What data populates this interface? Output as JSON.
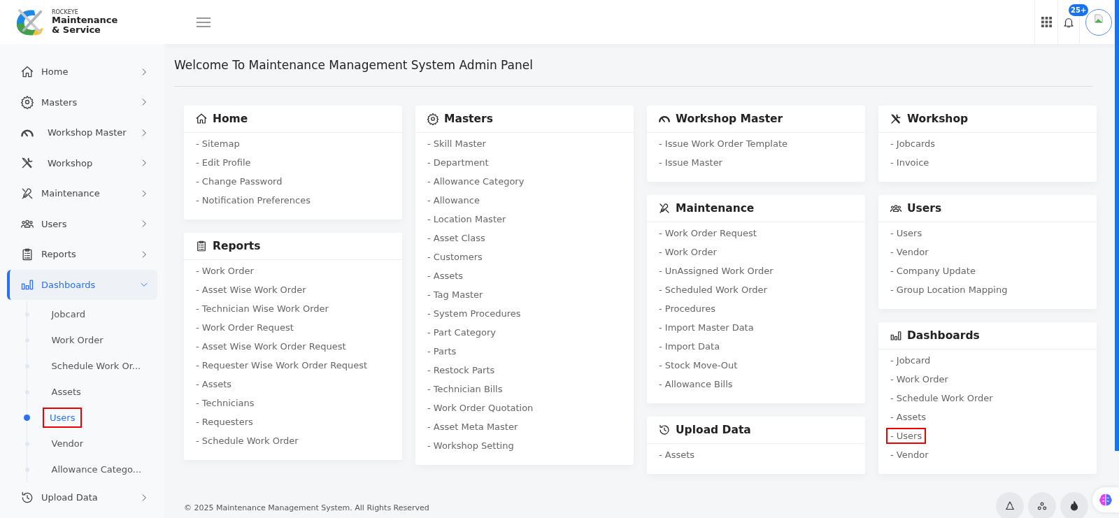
{
  "header": {
    "brand_small": "ROCKEYE",
    "brand_line1": "Maintenance",
    "brand_line2": "& Service",
    "notification_badge": "25+"
  },
  "sidebar": {
    "items": [
      {
        "label": "Home",
        "expanded": false,
        "selected": false
      },
      {
        "label": "Masters",
        "expanded": false,
        "selected": false
      },
      {
        "label": "Workshop Master",
        "expanded": false,
        "selected": false
      },
      {
        "label": "Workshop",
        "expanded": false,
        "selected": false
      },
      {
        "label": "Maintenance",
        "expanded": false,
        "selected": false
      },
      {
        "label": "Users",
        "expanded": false,
        "selected": false
      },
      {
        "label": "Reports",
        "expanded": false,
        "selected": false
      },
      {
        "label": "Dashboards",
        "expanded": true,
        "selected": true,
        "children": [
          {
            "label": "Jobcard",
            "selected": false,
            "highlighted": false
          },
          {
            "label": "Work Order",
            "selected": false,
            "highlighted": false
          },
          {
            "label": "Schedule Work Or...",
            "selected": false,
            "highlighted": false
          },
          {
            "label": "Assets",
            "selected": false,
            "highlighted": false
          },
          {
            "label": "Users",
            "selected": true,
            "highlighted": true
          },
          {
            "label": "Vendor",
            "selected": false,
            "highlighted": false
          },
          {
            "label": "Allowance Catego...",
            "selected": false,
            "highlighted": false
          }
        ]
      },
      {
        "label": "Upload Data",
        "expanded": false,
        "selected": false
      }
    ]
  },
  "main": {
    "title": "Welcome To Maintenance Management System Admin Panel",
    "card_columns": [
      [
        {
          "title": "Home",
          "items": [
            {
              "label": "- Sitemap",
              "highlighted": false
            },
            {
              "label": "- Edit Profile",
              "highlighted": false
            },
            {
              "label": "- Change Password",
              "highlighted": false
            },
            {
              "label": "- Notification Preferences",
              "highlighted": false
            }
          ]
        },
        {
          "title": "Reports",
          "items": [
            {
              "label": "- Work Order",
              "highlighted": false
            },
            {
              "label": "- Asset Wise Work Order",
              "highlighted": false
            },
            {
              "label": "- Technician Wise Work Order",
              "highlighted": false
            },
            {
              "label": "- Work Order Request",
              "highlighted": false
            },
            {
              "label": "- Asset Wise Work Order Request",
              "highlighted": false
            },
            {
              "label": "- Requester Wise Work Order Request",
              "highlighted": false
            },
            {
              "label": "- Assets",
              "highlighted": false
            },
            {
              "label": "- Technicians",
              "highlighted": false
            },
            {
              "label": "- Requesters",
              "highlighted": false
            },
            {
              "label": "- Schedule Work Order",
              "highlighted": false
            }
          ]
        }
      ],
      [
        {
          "title": "Masters",
          "items": [
            {
              "label": "- Skill Master",
              "highlighted": false
            },
            {
              "label": "- Department",
              "highlighted": false
            },
            {
              "label": "- Allowance Category",
              "highlighted": false
            },
            {
              "label": "- Allowance",
              "highlighted": false
            },
            {
              "label": "- Location Master",
              "highlighted": false
            },
            {
              "label": "- Asset Class",
              "highlighted": false
            },
            {
              "label": "- Customers",
              "highlighted": false
            },
            {
              "label": "- Assets",
              "highlighted": false
            },
            {
              "label": "- Tag Master",
              "highlighted": false
            },
            {
              "label": "- System Procedures",
              "highlighted": false
            },
            {
              "label": "- Part Category",
              "highlighted": false
            },
            {
              "label": "- Parts",
              "highlighted": false
            },
            {
              "label": "- Restock Parts",
              "highlighted": false
            },
            {
              "label": "- Technician Bills",
              "highlighted": false
            },
            {
              "label": "- Work Order Quotation",
              "highlighted": false
            },
            {
              "label": "- Asset Meta Master",
              "highlighted": false
            },
            {
              "label": "- Workshop Setting",
              "highlighted": false
            }
          ]
        }
      ],
      [
        {
          "title": "Workshop Master",
          "items": [
            {
              "label": "- Issue Work Order Template",
              "highlighted": false
            },
            {
              "label": "- Issue Master",
              "highlighted": false
            }
          ]
        },
        {
          "title": "Maintenance",
          "items": [
            {
              "label": "- Work Order Request",
              "highlighted": false
            },
            {
              "label": "- Work Order",
              "highlighted": false
            },
            {
              "label": "- UnAssigned Work Order",
              "highlighted": false
            },
            {
              "label": "- Scheduled Work Order",
              "highlighted": false
            },
            {
              "label": "- Procedures",
              "highlighted": false
            },
            {
              "label": "- Import Master Data",
              "highlighted": false
            },
            {
              "label": "- Import Data",
              "highlighted": false
            },
            {
              "label": "- Stock Move-Out",
              "highlighted": false
            },
            {
              "label": "- Allowance Bills",
              "highlighted": false
            }
          ]
        },
        {
          "title": "Upload Data",
          "items": [
            {
              "label": "- Assets",
              "highlighted": false
            }
          ]
        }
      ],
      [
        {
          "title": "Workshop",
          "items": [
            {
              "label": "- Jobcards",
              "highlighted": false
            },
            {
              "label": "- Invoice",
              "highlighted": false
            }
          ]
        },
        {
          "title": "Users",
          "items": [
            {
              "label": "- Users",
              "highlighted": false
            },
            {
              "label": "- Vendor",
              "highlighted": false
            },
            {
              "label": "- Company Update",
              "highlighted": false
            },
            {
              "label": "- Group Location Mapping",
              "highlighted": false
            }
          ]
        },
        {
          "title": "Dashboards",
          "items": [
            {
              "label": "- Jobcard",
              "highlighted": false
            },
            {
              "label": "- Work Order",
              "highlighted": false
            },
            {
              "label": "- Schedule Work Order",
              "highlighted": false
            },
            {
              "label": "- Assets",
              "highlighted": false
            },
            {
              "label": "- Users",
              "highlighted": true
            },
            {
              "label": "- Vendor",
              "highlighted": false
            }
          ]
        }
      ]
    ]
  },
  "footer": {
    "text": "© 2025 Maintenance Management System. All Rights Reserved"
  }
}
